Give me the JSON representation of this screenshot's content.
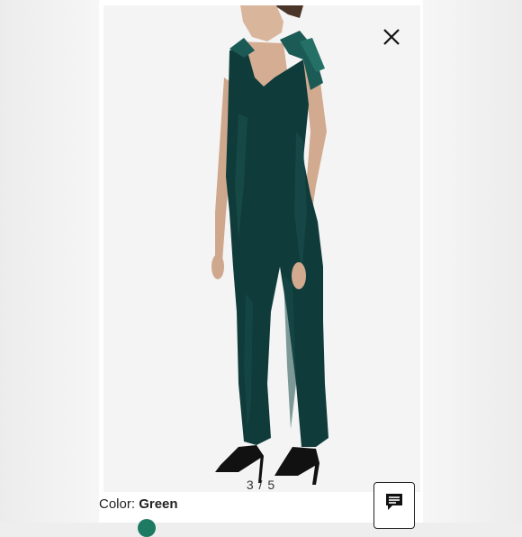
{
  "viewer": {
    "counter": "3 / 5",
    "color_label": "Color:",
    "color_value": "Green"
  },
  "icons": {
    "close": "close-icon",
    "chat": "chat-icon"
  },
  "colors": {
    "garment": "#0f3b3a",
    "swatch": "#1e7a62",
    "bow": "#1c5a55"
  }
}
